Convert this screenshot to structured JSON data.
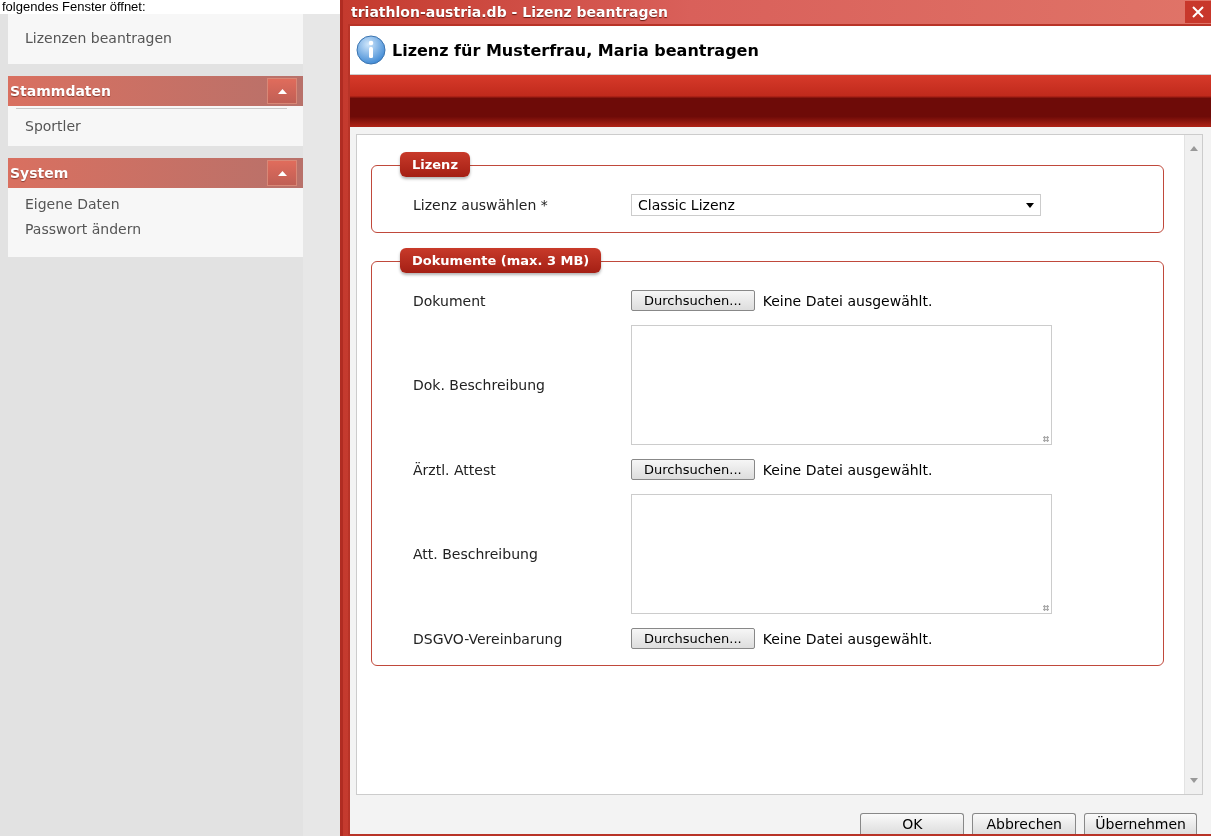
{
  "document_text": "folgendes Fenster öffnet:",
  "sidebar": {
    "top_items": [
      {
        "label": "Lizenzen beantragen"
      }
    ],
    "sections": [
      {
        "title": "Stammdaten",
        "expanded": true,
        "items": [
          {
            "label": "Sportler"
          }
        ]
      },
      {
        "title": "System",
        "expanded": true,
        "items": [
          {
            "label": "Eigene Daten"
          },
          {
            "label": "Passwort ändern"
          }
        ]
      }
    ]
  },
  "dialog": {
    "title": "triathlon-austria.db - Lizenz beantragen",
    "heading": "Lizenz für Musterfrau, Maria beantragen",
    "groups": [
      {
        "legend": "Lizenz",
        "rows": [
          {
            "kind": "select",
            "label": "Lizenz auswählen *",
            "value": "Classic Lizenz"
          }
        ]
      },
      {
        "legend": "Dokumente (max. 3 MB)",
        "rows": [
          {
            "kind": "file",
            "label": "Dokument",
            "button": "Durchsuchen...",
            "status": "Keine Datei ausgewählt."
          },
          {
            "kind": "textarea",
            "label": "Dok. Beschreibung"
          },
          {
            "kind": "file",
            "label": "Ärztl. Attest",
            "button": "Durchsuchen...",
            "status": "Keine Datei ausgewählt."
          },
          {
            "kind": "textarea",
            "label": "Att. Beschreibung"
          },
          {
            "kind": "file",
            "label": "DSGVO-Vereinbarung",
            "button": "Durchsuchen...",
            "status": "Keine Datei ausgewählt."
          }
        ]
      }
    ],
    "buttons": [
      "OK",
      "Abbrechen",
      "Übernehmen"
    ]
  }
}
